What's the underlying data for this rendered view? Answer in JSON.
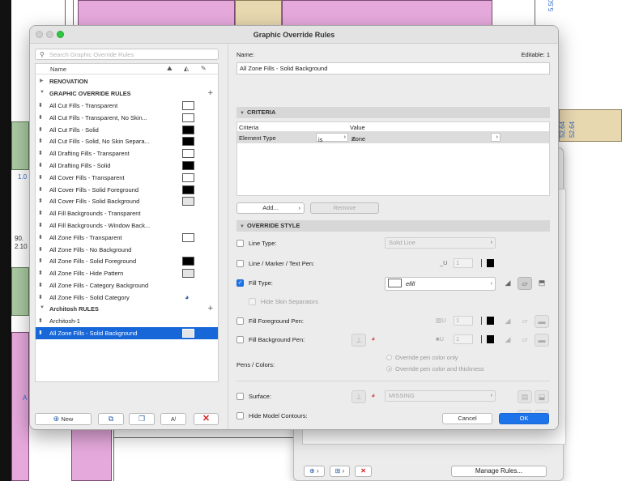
{
  "dialog": {
    "title": "Graphic Override Rules"
  },
  "search": {
    "placeholder": "Search Graphic Override Rules"
  },
  "list": {
    "header_name": "Name",
    "header_icons": [
      "visibility-icon",
      "palette-icon",
      "pen-icon"
    ],
    "groups": [
      {
        "label": "RENOVATION",
        "collapsed": true,
        "has_add": false
      },
      {
        "label": "GRAPHIC OVERRIDE RULES",
        "collapsed": false,
        "has_add": true
      },
      {
        "label": "Architosh RULES",
        "collapsed": false,
        "has_add": true
      }
    ],
    "rules": [
      {
        "label": "All Cut Fills - Transparent",
        "swatch": "white"
      },
      {
        "label": "All Cut Fills - Transparent, No Skin...",
        "swatch": "white"
      },
      {
        "label": "All Cut Fills - Solid",
        "swatch": "black"
      },
      {
        "label": "All Cut Fills - Solid, No Skin Separa...",
        "swatch": "black"
      },
      {
        "label": "All Drafting Fills - Transparent",
        "swatch": "white"
      },
      {
        "label": "All Drafting Fills - Solid",
        "swatch": "black"
      },
      {
        "label": "All Cover Fills - Transparent",
        "swatch": "white"
      },
      {
        "label": "All Cover Fills - Solid Foreground",
        "swatch": "black"
      },
      {
        "label": "All Cover Fills - Solid Background",
        "swatch": "gray"
      },
      {
        "label": "All Fill Backgrounds - Transparent",
        "swatch": "none"
      },
      {
        "label": "All Fill Backgrounds - Window Back...",
        "swatch": "none"
      },
      {
        "label": "All Zone Fills - Transparent",
        "swatch": "white"
      },
      {
        "label": "All Zone Fills - No Background",
        "swatch": "none"
      },
      {
        "label": "All Zone Fills - Solid Foreground",
        "swatch": "black"
      },
      {
        "label": "All Zone Fills - Hide Pattern",
        "swatch": "gray"
      },
      {
        "label": "All Zone Fills - Category Background",
        "swatch": "none"
      },
      {
        "label": "All Zone Fills - Solid Category",
        "swatch": "palette"
      }
    ],
    "architosh_rules": [
      {
        "label": "Architosh-1",
        "swatch": "none"
      },
      {
        "label": "All Zone Fills - Solid Background",
        "swatch": "gray",
        "selected": true
      }
    ]
  },
  "left_buttons": {
    "new_label": "New",
    "new_icon": "plus-circle-icon",
    "import_icon": "import-icon",
    "duplicate_icon": "duplicate-icon",
    "rename_icon": "rename-icon",
    "delete_icon": "delete-x-icon"
  },
  "details": {
    "name_label": "Name:",
    "editable_label": "Editable: 1",
    "name_value": "All Zone Fills - Solid Background",
    "criteria_title": "CRITERIA",
    "criteria_col": "Criteria",
    "value_col": "Value",
    "criteria_row": {
      "criteria": "Element Type",
      "operator": "is",
      "value": "Zone"
    },
    "add_label": "Add...",
    "remove_label": "Remove",
    "override_title": "OVERRIDE STYLE",
    "line_type_label": "Line Type:",
    "line_type_value": "Solid Line",
    "line_pen_label": "Line / Marker / Text Pen:",
    "pen_number": "1",
    "fill_type_label": "Fill Type:",
    "fill_type_value": "efill",
    "hide_skin_label": "Hide Skin Separators",
    "fill_fg_label": "Fill Foreground Pen:",
    "fill_bg_label": "Fill Background Pen:",
    "pens_colors_label": "Pens / Colors:",
    "radio_color_only": "Override pen color only",
    "radio_color_thickness": "Override pen color and thickness",
    "surface_label": "Surface:",
    "surface_value": "MISSING",
    "hide_contours_label": "Hide Model Contours:",
    "cancel_label": "Cancel",
    "ok_label": "OK"
  },
  "background": {
    "labels": [
      "5.50",
      "52.64",
      "52.64",
      "1.0",
      "90.",
      "2.10",
      "A"
    ]
  },
  "window2": {
    "manage_label": "Manage Rules..."
  },
  "colors": {
    "selection": "#1767d9",
    "primary_button": "#1d73ea",
    "zone_pink": "#e6a9dc",
    "zone_green": "#a9c9a1",
    "zone_tan": "#e8d8b0"
  }
}
